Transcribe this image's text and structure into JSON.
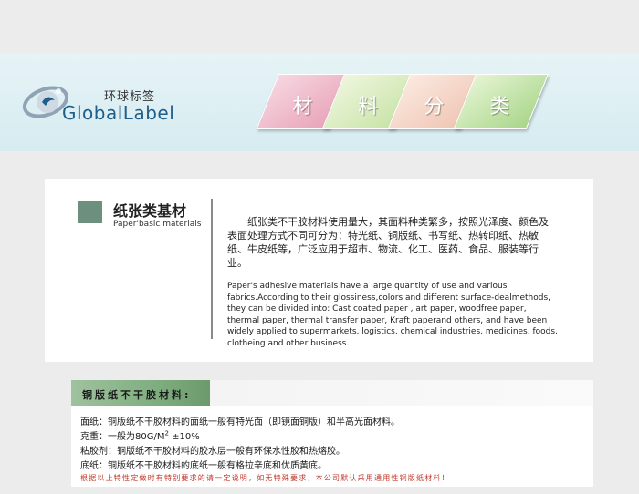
{
  "header": {
    "logo_cn": "环球标签",
    "logo_en": "GlobalLabel",
    "title_chars": [
      "材",
      "料",
      "分",
      "类"
    ]
  },
  "section": {
    "title": "纸张类基材",
    "subtitle": "Paper'basic materials",
    "desc_cn": "纸张类不干胶材料使用量大，其面料种类繁多，按照光泽度、颜色及表面处理方式不同可分为：特光纸、铜版纸、书写纸、热转印纸、热敏纸、牛皮纸等，广泛应用于超市、物流、化工、医药、食品、服装等行业。",
    "desc_en": "Paper's adhesive materials have a large quantity of use and various fabrics.According to their glossiness,colors and different surface-dealmethods, they can be divided into: Cast coated paper , art paper, woodfree paper, thermal paper, thermal transfer paper,  Kraft paperand others, and have been widely applied to supermarkets, logistics, chemical industries, medicines, foods, clotheing and other business."
  },
  "coated": {
    "heading": "铜版纸不干胶材料:",
    "line1": "面纸：铜版纸不干胶材料的面纸一般有特光面（即镜面铜版）和半高光面材料。",
    "line2_pre": "克重：一般为80G/M",
    "line2_sup": "2",
    "line2_post": " ±10%",
    "line3": "粘胶剂：铜版纸不干胶材料的胶水层一般有环保水性胶和热熔胶。",
    "line4": "底纸：铜版纸不干胶材料的底纸一般有格拉辛底和优质黄底。",
    "note": "根据以上特性定做时有特别要求的请一定说明，如无特殊要求，本公司默认采用通用性铜版纸材料！"
  },
  "colors": {
    "accent": "#6d8f7e",
    "header_green": "#7fae80",
    "note_red": "#c0392b",
    "logo_blue": "#1f5d8a"
  }
}
